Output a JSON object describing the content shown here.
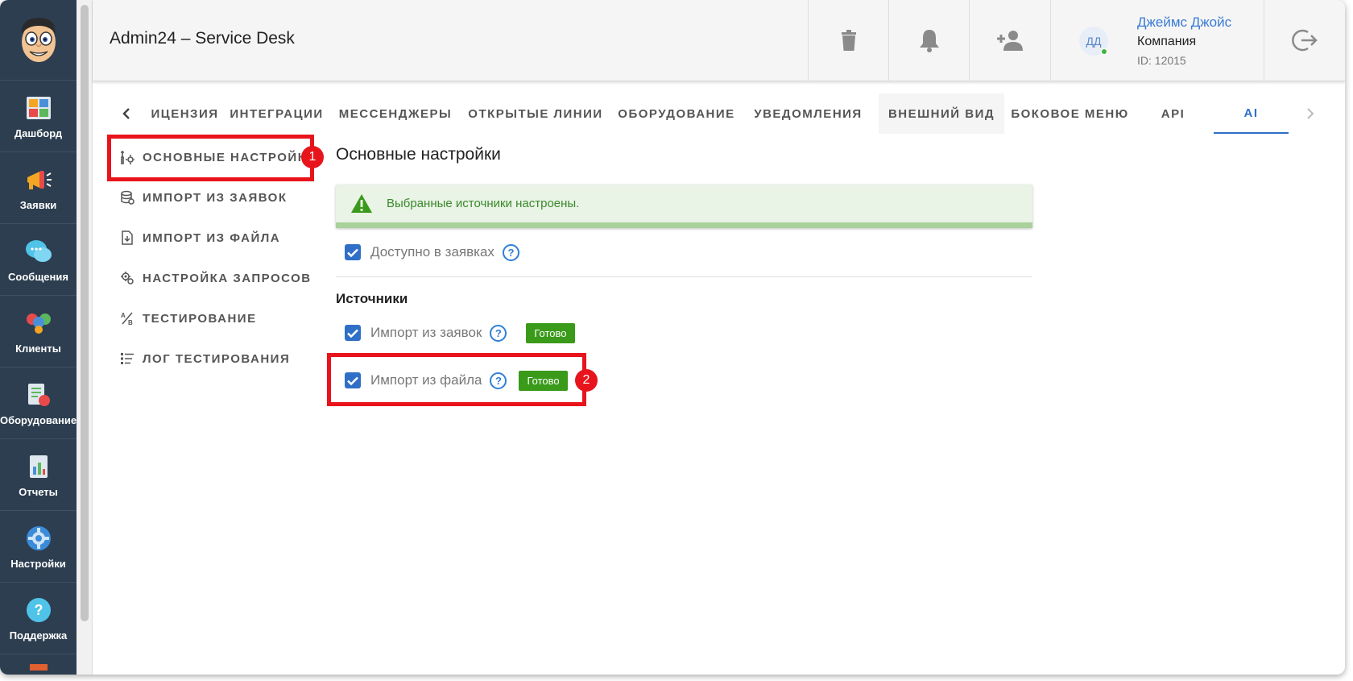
{
  "app": {
    "title": "Admin24 – Service Desk"
  },
  "sidebar": {
    "items": [
      {
        "label": "Дашборд",
        "icon": "dashboard-icon"
      },
      {
        "label": "Заявки",
        "icon": "megaphone-icon"
      },
      {
        "label": "Сообщения",
        "icon": "chat-bubbles-icon"
      },
      {
        "label": "Клиенты",
        "icon": "clients-icon"
      },
      {
        "label": "Оборудование",
        "icon": "equipment-icon"
      },
      {
        "label": "Отчеты",
        "icon": "report-icon"
      },
      {
        "label": "Настройки",
        "icon": "gear-icon"
      },
      {
        "label": "Поддержка",
        "icon": "help-icon"
      }
    ]
  },
  "header": {
    "user": {
      "initials": "ДД",
      "name": "Джеймс Джойс",
      "company": "Компания",
      "id_text": "ID: 12015"
    }
  },
  "tabs": {
    "items": [
      {
        "label": "ИЦЕНЗИЯ"
      },
      {
        "label": "ИНТЕГРАЦИИ"
      },
      {
        "label": "МЕССЕНДЖЕРЫ"
      },
      {
        "label": "ОТКРЫТЫЕ ЛИНИИ"
      },
      {
        "label": "ОБОРУДОВАНИЕ"
      },
      {
        "label": "УВЕДОМЛЕНИЯ"
      },
      {
        "label": "ВНЕШНИЙ ВИД"
      },
      {
        "label": "БОКОВОЕ МЕНЮ"
      },
      {
        "label": "API"
      },
      {
        "label": "AI"
      }
    ],
    "active": "AI"
  },
  "settings_menu": {
    "items": [
      {
        "label": "ОСНОВНЫЕ НАСТРОЙКИ"
      },
      {
        "label": "ИМПОРТ ИЗ ЗАЯВОК"
      },
      {
        "label": "ИМПОРТ ИЗ ФАЙЛА"
      },
      {
        "label": "НАСТРОЙКА ЗАПРОСОВ"
      },
      {
        "label": "ТЕСТИРОВАНИЕ"
      },
      {
        "label": "ЛОГ ТЕСТИРОВАНИЯ"
      }
    ]
  },
  "main": {
    "title": "Основные настройки",
    "alert_text": "Выбранные источники настроены.",
    "available_label": "Доступно в заявках",
    "available_checked": true,
    "sources_title": "Источники",
    "sources": [
      {
        "label": "Импорт из заявок",
        "checked": true,
        "status": "Готово"
      },
      {
        "label": "Импорт из файла",
        "checked": true,
        "status": "Готово"
      }
    ],
    "help_glyph": "?"
  },
  "annotations": {
    "marker1": "1",
    "marker2": "2"
  },
  "colors": {
    "sidebar_bg": "#2d3e50",
    "accent": "#2f6fc7",
    "ready_badge": "#3a9a1a",
    "alert_text": "#3a8a2a",
    "highlight": "#e8141c"
  }
}
